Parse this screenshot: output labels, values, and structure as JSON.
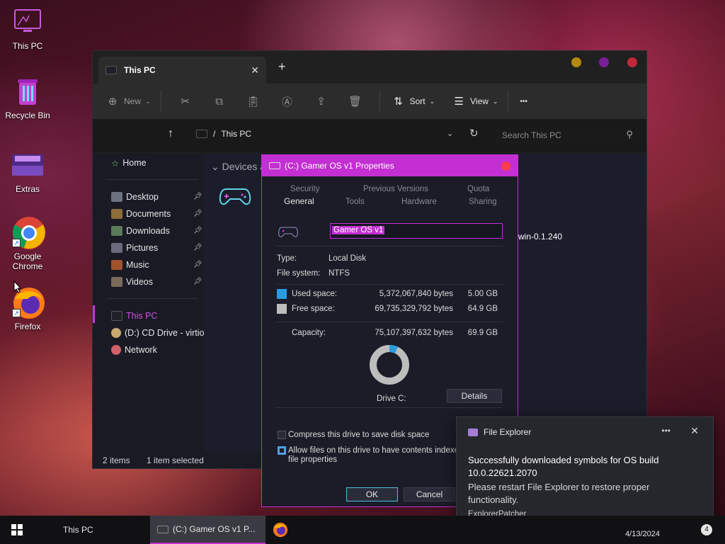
{
  "desktop": {
    "icons": [
      {
        "label": "This PC",
        "icon": "monitor-icon"
      },
      {
        "label": "Recycle Bin",
        "icon": "recycle-bin-icon"
      },
      {
        "label": "Extras",
        "icon": "extras-image-icon"
      },
      {
        "label": "Google Chrome",
        "icon": "chrome-icon"
      },
      {
        "label": "Firefox",
        "icon": "firefox-icon"
      }
    ]
  },
  "explorer": {
    "tab_title": "This PC",
    "new_tab": "+",
    "tab_close": "✕",
    "toolbar": {
      "new_label": "New",
      "sort_label": "Sort",
      "view_label": "View",
      "more": "•••"
    },
    "address": {
      "separator": "/",
      "location": "This PC",
      "search_placeholder": "Search This PC"
    },
    "sidebar": {
      "home": "Home",
      "quick": [
        {
          "label": "Desktop",
          "color": "#6b7280"
        },
        {
          "label": "Documents",
          "color": "#8b6e3a"
        },
        {
          "label": "Downloads",
          "color": "#5a7a5a"
        },
        {
          "label": "Pictures",
          "color": "#6a6a7a"
        },
        {
          "label": "Music",
          "color": "#a0522d"
        },
        {
          "label": "Videos",
          "color": "#7a6a5a"
        }
      ],
      "this_pc": "This PC",
      "cd_drive": "(D:) CD Drive - virtio-",
      "network": "Network"
    },
    "content": {
      "group_header": "Devices a",
      "cd_label_tail": "win-0.1.240"
    },
    "status": {
      "items": "2 items",
      "selected": "1 item selected"
    }
  },
  "properties": {
    "title": "(C:) Gamer OS v1 Properties",
    "tabs_top": [
      "Security",
      "Previous Versions",
      "Quota"
    ],
    "tabs_bottom": [
      "General",
      "Tools",
      "Hardware",
      "Sharing"
    ],
    "active_tab": "General",
    "name_value": "Gamer OS v1",
    "type_label": "Type:",
    "type_value": "Local Disk",
    "fs_label": "File system:",
    "fs_value": "NTFS",
    "used_label": "Used space:",
    "used_bytes": "5,372,067,840 bytes",
    "used_gb": "5.00 GB",
    "used_color": "#2b9be0",
    "free_label": "Free space:",
    "free_bytes": "69,735,329,792 bytes",
    "free_gb": "64.9 GB",
    "free_color": "#bdbdbd",
    "capacity_label": "Capacity:",
    "capacity_bytes": "75,107,397,632 bytes",
    "capacity_gb": "69.9 GB",
    "used_fraction": 0.0715,
    "drive_label": "Drive C:",
    "details_btn": "Details",
    "compress_label": "Compress this drive to save disk space",
    "compress_checked": false,
    "index_label_1": "Allow files on this drive to have contents indexed in",
    "index_label_2": "file properties",
    "index_checked": true,
    "ok": "OK",
    "cancel": "Cancel"
  },
  "toast": {
    "app": "File Explorer",
    "more": "•••",
    "close": "✕",
    "heading": "Successfully downloaded symbols for OS build 10.0.22621.2070",
    "body": "Please restart File Explorer to restore proper functionality.",
    "attribution": "ExplorerPatcher"
  },
  "taskbar": {
    "items": [
      {
        "label": "This PC"
      },
      {
        "label": "(C:) Gamer OS v1 P..."
      }
    ],
    "date": "4/13/2024",
    "notification_count": "4"
  }
}
